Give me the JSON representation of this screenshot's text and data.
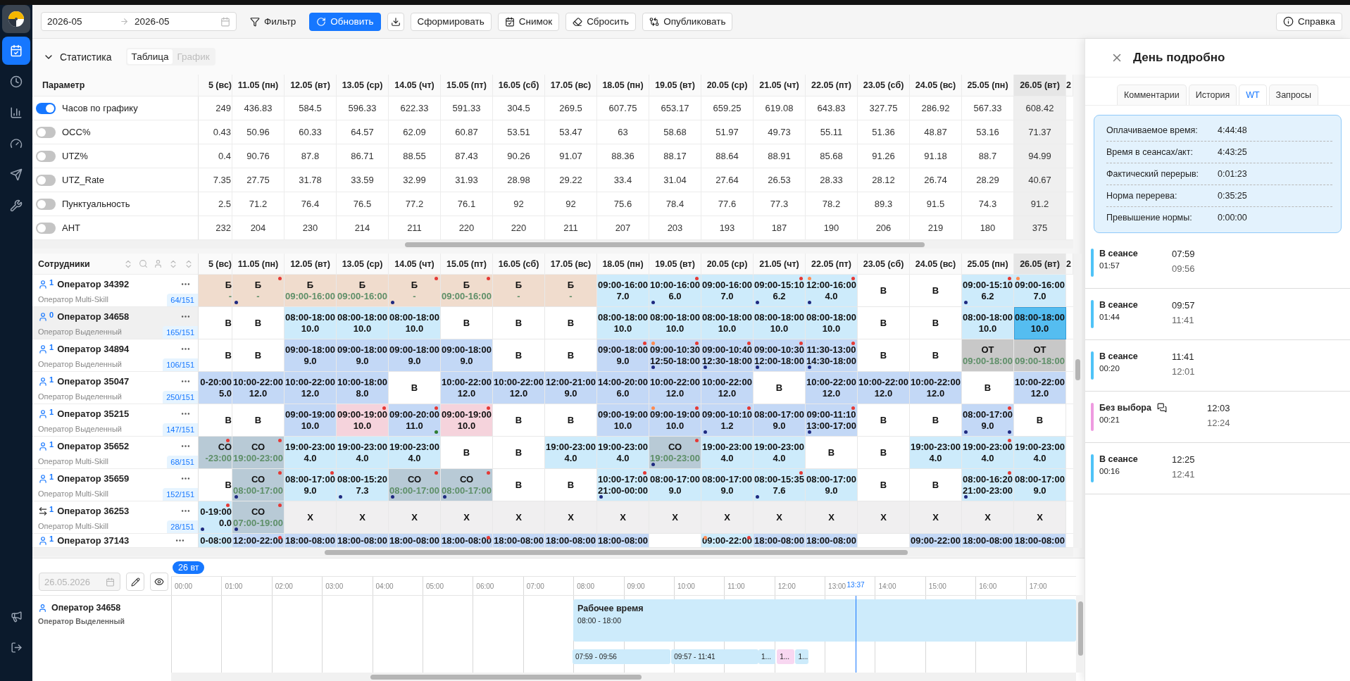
{
  "sidebar": {
    "items": [
      {
        "selected": true
      },
      {
        "selected": false
      },
      {
        "selected": false
      },
      {
        "selected": false
      },
      {
        "selected": false
      },
      {
        "selected": false
      }
    ]
  },
  "toolbar": {
    "date_from": "2026-05",
    "date_to": "2026-05",
    "buttons": [
      {
        "kind": "plain",
        "label": "Фильтр"
      },
      {
        "kind": "primary",
        "label": "Обновить"
      },
      {
        "kind": "icon"
      },
      {
        "kind": "outline",
        "label": "Сформировать"
      },
      {
        "kind": "outline",
        "label": "Снимок"
      },
      {
        "kind": "outline",
        "label": "Сбросить"
      },
      {
        "kind": "outline",
        "label": "Опубликовать"
      }
    ],
    "help": "Справка"
  },
  "stats": {
    "title": "Статистика",
    "expanded": true,
    "views": [
      {
        "label": "Таблица",
        "selected": true
      },
      {
        "label": "График",
        "selected": false
      }
    ],
    "param_header": "Параметр",
    "columns": [
      {
        "label": "5 (вс)",
        "kind": "cut-left",
        "selected": false
      },
      {
        "label": "11.05 (пн)",
        "kind": "day",
        "selected": false
      },
      {
        "label": "12.05 (вт)",
        "kind": "day",
        "selected": false
      },
      {
        "label": "13.05 (ср)",
        "kind": "day",
        "selected": false
      },
      {
        "label": "14.05 (чт)",
        "kind": "day",
        "selected": false
      },
      {
        "label": "15.05 (пт)",
        "kind": "day",
        "selected": false
      },
      {
        "label": "16.05 (сб)",
        "kind": "day",
        "selected": false
      },
      {
        "label": "17.05 (вс)",
        "kind": "day",
        "selected": false
      },
      {
        "label": "18.05 (пн)",
        "kind": "day",
        "selected": false
      },
      {
        "label": "19.05 (вт)",
        "kind": "day",
        "selected": false
      },
      {
        "label": "20.05 (ср)",
        "kind": "day",
        "selected": false
      },
      {
        "label": "21.05 (чт)",
        "kind": "day",
        "selected": false
      },
      {
        "label": "22.05 (пт)",
        "kind": "day",
        "selected": false
      },
      {
        "label": "23.05 (сб)",
        "kind": "day",
        "selected": false
      },
      {
        "label": "24.05 (вс)",
        "kind": "day",
        "selected": false
      },
      {
        "label": "25.05 (пн)",
        "kind": "day",
        "selected": false
      },
      {
        "label": "26.05 (вт)",
        "kind": "day",
        "selected": true
      },
      {
        "label": "2",
        "kind": "cut-right",
        "selected": false
      }
    ],
    "rows": [
      {
        "label": "Часов по графику",
        "on": true,
        "values": [
          "249",
          "436.83",
          "584.5",
          "596.33",
          "622.33",
          "591.33",
          "304.5",
          "269.5",
          "607.75",
          "653.17",
          "659.25",
          "619.08",
          "643.83",
          "327.75",
          "286.92",
          "567.33",
          "608.42"
        ]
      },
      {
        "label": "OCC%",
        "on": false,
        "values": [
          "0.43",
          "50.96",
          "60.33",
          "64.57",
          "62.09",
          "60.87",
          "53.51",
          "53.47",
          "63",
          "58.68",
          "51.97",
          "49.73",
          "55.11",
          "51.36",
          "48.87",
          "53.16",
          "71.37"
        ]
      },
      {
        "label": "UTZ%",
        "on": false,
        "values": [
          "0.4",
          "90.76",
          "87.8",
          "86.71",
          "88.55",
          "87.43",
          "90.26",
          "91.07",
          "88.36",
          "88.17",
          "88.64",
          "88.91",
          "85.68",
          "91.26",
          "91.18",
          "88.7",
          "94.99"
        ]
      },
      {
        "label": "UTZ_Rate",
        "on": false,
        "values": [
          "7.35",
          "27.75",
          "31.78",
          "33.59",
          "32.99",
          "31.93",
          "28.98",
          "29.22",
          "33.4",
          "31.04",
          "27.64",
          "26.53",
          "28.33",
          "28.12",
          "26.74",
          "28.29",
          "40.67"
        ]
      },
      {
        "label": "Пунктуальность",
        "on": false,
        "values": [
          "2.5",
          "71.2",
          "76.4",
          "76.5",
          "77.2",
          "76.1",
          "92",
          "92",
          "75.6",
          "78.4",
          "77.6",
          "77.3",
          "78.2",
          "89.3",
          "91.5",
          "74.3",
          "91.2"
        ]
      },
      {
        "label": "AHT",
        "on": false,
        "values": [
          "232",
          "204",
          "230",
          "214",
          "211",
          "220",
          "220",
          "211",
          "207",
          "203",
          "193",
          "187",
          "190",
          "206",
          "219",
          "180",
          "375"
        ]
      }
    ]
  },
  "schedule": {
    "header": "Сотрудники",
    "columns": [
      {
        "label": "5 (вс)",
        "kind": "cut-left",
        "selected": false
      },
      {
        "label": "11.05 (пн)",
        "kind": "day",
        "selected": false
      },
      {
        "label": "12.05 (вт)",
        "kind": "day",
        "selected": false
      },
      {
        "label": "13.05 (ср)",
        "kind": "day",
        "selected": false
      },
      {
        "label": "14.05 (чт)",
        "kind": "day",
        "selected": false
      },
      {
        "label": "15.05 (пт)",
        "kind": "day",
        "selected": false
      },
      {
        "label": "16.05 (сб)",
        "kind": "day",
        "selected": false
      },
      {
        "label": "17.05 (вс)",
        "kind": "day",
        "selected": false
      },
      {
        "label": "18.05 (пн)",
        "kind": "day",
        "selected": false
      },
      {
        "label": "19.05 (вт)",
        "kind": "day",
        "selected": false
      },
      {
        "label": "20.05 (ср)",
        "kind": "day",
        "selected": false
      },
      {
        "label": "21.05 (чт)",
        "kind": "day",
        "selected": false
      },
      {
        "label": "22.05 (пт)",
        "kind": "day",
        "selected": false
      },
      {
        "label": "23.05 (сб)",
        "kind": "day",
        "selected": false
      },
      {
        "label": "24.05 (вс)",
        "kind": "day",
        "selected": false
      },
      {
        "label": "25.05 (пн)",
        "kind": "day",
        "selected": false
      },
      {
        "label": "26.05 (вт)",
        "kind": "day",
        "selected": true
      },
      {
        "label": "2",
        "kind": "cut-right",
        "selected": false
      }
    ],
    "rows": [
      {
        "name": "Оператор 34392",
        "kind": "person",
        "sup": "1",
        "role": "Оператор Multi-Skill",
        "load": "64/151",
        "selected": false,
        "cut": false,
        "cells": [
          {
            "kind": "sick",
            "lines": [
              "Б",
              "-"
            ]
          },
          {
            "kind": "sick",
            "lines": [
              "Б",
              "-"
            ],
            "dots": [
              {
                "kind": "top-right",
                "color": "#e53935"
              },
              {
                "kind": "bottom-left",
                "color": "#1f2a80"
              }
            ]
          },
          {
            "kind": "sick",
            "lines": [
              "Б",
              "09:00-16:00"
            ]
          },
          {
            "kind": "sick",
            "lines": [
              "Б",
              "09:00-16:00"
            ]
          },
          {
            "kind": "sick",
            "lines": [
              "Б",
              "-"
            ],
            "dots": [
              {
                "kind": "top-right",
                "color": "#e53935"
              },
              {
                "kind": "bottom-left",
                "color": "#1f2a80"
              }
            ]
          },
          {
            "kind": "sick",
            "lines": [
              "Б",
              "09:00-16:00"
            ],
            "dots": [
              {
                "kind": "top-right",
                "color": "#e53935"
              }
            ]
          },
          {
            "kind": "sick",
            "lines": [
              "Б",
              "-"
            ]
          },
          {
            "kind": "sick",
            "lines": [
              "Б",
              "-"
            ]
          },
          {
            "kind": "shift",
            "lines": [
              "09:00-16:00",
              "7.0"
            ]
          },
          {
            "kind": "shift",
            "lines": [
              "10:00-16:00",
              "6.0"
            ],
            "dots": [
              {
                "kind": "top-right",
                "color": "#e53935"
              },
              {
                "kind": "bottom-left",
                "color": "#1f2a80"
              }
            ]
          },
          {
            "kind": "shift",
            "lines": [
              "09:00-16:00",
              "7.0"
            ]
          },
          {
            "kind": "shift",
            "lines": [
              "09:00-15:10",
              "6.2"
            ],
            "dots": [
              {
                "kind": "top-right",
                "color": "#e53935"
              },
              {
                "kind": "bottom-left",
                "color": "#1f2a80"
              }
            ]
          },
          {
            "kind": "shift",
            "lines": [
              "12:00-16:00",
              "4.0"
            ],
            "dots": [
              {
                "kind": "top-left",
                "color": "#ff8a50"
              },
              {
                "kind": "top-right",
                "color": "#e53935"
              },
              {
                "kind": "bottom-left",
                "color": "#1f2a80"
              }
            ]
          },
          {
            "kind": "off",
            "lines": [
              "В"
            ]
          },
          {
            "kind": "off",
            "lines": [
              "В"
            ]
          },
          {
            "kind": "shift",
            "lines": [
              "09:00-15:10",
              "6.2"
            ],
            "dots": [
              {
                "kind": "top-right",
                "color": "#e53935"
              },
              {
                "kind": "bottom-left",
                "color": "#1f2a80"
              }
            ]
          },
          {
            "kind": "shift",
            "lines": [
              "09:00-16:00",
              "7.0"
            ],
            "dots": [
              {
                "kind": "top-left",
                "color": "#ff8a50"
              }
            ]
          }
        ]
      },
      {
        "name": "Оператор 34658",
        "kind": "person",
        "sup": "0",
        "role": "Оператор Выделенный",
        "load": "165/151",
        "selected": true,
        "cut": false,
        "cells": [
          {
            "kind": "off",
            "lines": [
              "В"
            ]
          },
          {
            "kind": "off",
            "lines": [
              "В"
            ]
          },
          {
            "kind": "shift",
            "lines": [
              "08:00-18:00",
              "10.0"
            ]
          },
          {
            "kind": "shift",
            "lines": [
              "08:00-18:00",
              "10.0"
            ]
          },
          {
            "kind": "shift",
            "lines": [
              "08:00-18:00",
              "10.0"
            ]
          },
          {
            "kind": "off",
            "lines": [
              "В"
            ]
          },
          {
            "kind": "off",
            "lines": [
              "В"
            ]
          },
          {
            "kind": "off",
            "lines": [
              "В"
            ]
          },
          {
            "kind": "shift",
            "lines": [
              "08:00-18:00",
              "10.0"
            ]
          },
          {
            "kind": "shift",
            "lines": [
              "08:00-18:00",
              "10.0"
            ]
          },
          {
            "kind": "shift",
            "lines": [
              "08:00-18:00",
              "10.0"
            ]
          },
          {
            "kind": "shift",
            "lines": [
              "08:00-18:00",
              "10.0"
            ]
          },
          {
            "kind": "shift",
            "lines": [
              "08:00-18:00",
              "10.0"
            ]
          },
          {
            "kind": "off",
            "lines": [
              "В"
            ]
          },
          {
            "kind": "off",
            "lines": [
              "В"
            ]
          },
          {
            "kind": "shift",
            "lines": [
              "08:00-18:00",
              "10.0"
            ]
          },
          {
            "kind": "selected",
            "lines": [
              "08:00-18:00",
              "10.0"
            ]
          }
        ]
      },
      {
        "name": "Оператор 34894",
        "kind": "person",
        "sup": "1",
        "role": "Оператор Выделенный",
        "load": "106/151",
        "selected": false,
        "cut": false,
        "cells": [
          {
            "kind": "off",
            "lines": [
              "В"
            ]
          },
          {
            "kind": "off",
            "lines": [
              "В"
            ]
          },
          {
            "kind": "shift2",
            "lines": [
              "09:00-18:00",
              "9.0"
            ]
          },
          {
            "kind": "shift2",
            "lines": [
              "09:00-18:00",
              "9.0"
            ]
          },
          {
            "kind": "shift2",
            "lines": [
              "09:00-18:00",
              "9.0"
            ]
          },
          {
            "kind": "shift2",
            "lines": [
              "09:00-18:00",
              "9.0"
            ]
          },
          {
            "kind": "off",
            "lines": [
              "В"
            ]
          },
          {
            "kind": "off",
            "lines": [
              "В"
            ]
          },
          {
            "kind": "shift2",
            "lines": [
              "09:00-18:00",
              "9.0"
            ],
            "dots": [
              {
                "kind": "top-right",
                "color": "#e53935"
              }
            ]
          },
          {
            "kind": "shift2",
            "lines": [
              "09:00-10:30",
              "12:50-18:00"
            ],
            "dots": [
              {
                "kind": "top-left",
                "color": "#ff8a50"
              },
              {
                "kind": "top-right",
                "color": "#e53935"
              },
              {
                "kind": "bottom-left",
                "color": "#1f2a80"
              }
            ]
          },
          {
            "kind": "shift2",
            "lines": [
              "09:00-10:40",
              "12:30-18:00"
            ],
            "dots": [
              {
                "kind": "top-right",
                "color": "#e53935"
              },
              {
                "kind": "bottom-left",
                "color": "#1f2a80"
              }
            ]
          },
          {
            "kind": "shift2",
            "lines": [
              "09:00-10:30",
              "12:00-18:00"
            ],
            "dots": [
              {
                "kind": "top-right",
                "color": "#e53935"
              },
              {
                "kind": "bottom-left",
                "color": "#1f2a80"
              }
            ]
          },
          {
            "kind": "shift2",
            "lines": [
              "11:30-13:00",
              "14:30-18:00"
            ],
            "dots": [
              {
                "kind": "top-right",
                "color": "#e53935"
              },
              {
                "kind": "bottom-left",
                "color": "#1f2a80"
              }
            ]
          },
          {
            "kind": "off",
            "lines": [
              "В"
            ]
          },
          {
            "kind": "off",
            "lines": [
              "В"
            ]
          },
          {
            "kind": "ot",
            "lines": [
              "ОТ",
              "09:00-18:00"
            ]
          },
          {
            "kind": "ot",
            "lines": [
              "ОТ",
              "09:00-18:00"
            ]
          }
        ]
      },
      {
        "name": "Оператор 35047",
        "kind": "person",
        "sup": "1",
        "role": "Оператор Выделенный",
        "load": "250/151",
        "selected": false,
        "cut": false,
        "cells": [
          {
            "kind": "shift2",
            "lines": [
              "0-20:00",
              "5.0"
            ]
          },
          {
            "kind": "shift2",
            "lines": [
              "10:00-22:00",
              "12.0"
            ]
          },
          {
            "kind": "shift2",
            "lines": [
              "10:00-22:00",
              "12.0"
            ]
          },
          {
            "kind": "shift2",
            "lines": [
              "10:00-18:00",
              "8.0"
            ]
          },
          {
            "kind": "off",
            "lines": [
              "В"
            ]
          },
          {
            "kind": "shift2",
            "lines": [
              "10:00-22:00",
              "12.0"
            ]
          },
          {
            "kind": "shift2",
            "lines": [
              "10:00-22:00",
              "12.0"
            ]
          },
          {
            "kind": "shift2",
            "lines": [
              "12:00-21:00",
              "9.0"
            ]
          },
          {
            "kind": "shift2",
            "lines": [
              "14:00-20:00",
              "6.0"
            ]
          },
          {
            "kind": "shift2",
            "lines": [
              "10:00-22:00",
              "12.0"
            ]
          },
          {
            "kind": "shift2",
            "lines": [
              "10:00-22:00",
              "12.0"
            ]
          },
          {
            "kind": "off",
            "lines": [
              "В"
            ]
          },
          {
            "kind": "shift2",
            "lines": [
              "10:00-22:00",
              "12.0"
            ]
          },
          {
            "kind": "shift2",
            "lines": [
              "10:00-22:00",
              "12.0"
            ]
          },
          {
            "kind": "shift2",
            "lines": [
              "10:00-22:00",
              "12.0"
            ]
          },
          {
            "kind": "off",
            "lines": [
              "В"
            ]
          },
          {
            "kind": "shift2",
            "lines": [
              "10:00-22:00",
              "12.0"
            ]
          }
        ]
      },
      {
        "name": "Оператор 35215",
        "kind": "person",
        "sup": "1",
        "role": "Оператор Выделенный",
        "load": "147/151",
        "selected": false,
        "cut": false,
        "cells": [
          {
            "kind": "off",
            "lines": [
              "В"
            ]
          },
          {
            "kind": "off",
            "lines": [
              "В"
            ]
          },
          {
            "kind": "shift2",
            "lines": [
              "09:00-19:00",
              "10.0"
            ]
          },
          {
            "kind": "pink",
            "lines": [
              "09:00-19:00",
              "10.0"
            ],
            "dots": [
              {
                "kind": "top-right",
                "color": "#e53935"
              }
            ]
          },
          {
            "kind": "shift2",
            "lines": [
              "09:00-20:00",
              "11.0"
            ],
            "dots": [
              {
                "kind": "top-right",
                "color": "#e53935"
              },
              {
                "kind": "bottom-right",
                "color": "#2e7d32"
              }
            ]
          },
          {
            "kind": "pink",
            "lines": [
              "09:00-19:00",
              "10.0"
            ],
            "dots": [
              {
                "kind": "top-right",
                "color": "#e53935"
              }
            ]
          },
          {
            "kind": "off",
            "lines": [
              "В"
            ]
          },
          {
            "kind": "off",
            "lines": [
              "В"
            ]
          },
          {
            "kind": "shift2",
            "lines": [
              "09:00-19:00",
              "10.0"
            ]
          },
          {
            "kind": "shift2",
            "lines": [
              "09:00-19:00",
              "10.0"
            ],
            "dots": [
              {
                "kind": "top-left",
                "color": "#ff8a50"
              },
              {
                "kind": "top-right",
                "color": "#e53935"
              }
            ]
          },
          {
            "kind": "shift2",
            "lines": [
              "09:00-10:10",
              "1.2"
            ],
            "dots": [
              {
                "kind": "top-right",
                "color": "#e53935"
              },
              {
                "kind": "bottom-left",
                "color": "#1f2a80"
              }
            ]
          },
          {
            "kind": "shift2",
            "lines": [
              "08:00-17:00",
              "9.0"
            ]
          },
          {
            "kind": "shift2",
            "lines": [
              "09:00-11:10",
              "13:00-17:00"
            ],
            "dots": [
              {
                "kind": "top-right",
                "color": "#e53935"
              },
              {
                "kind": "bottom-left",
                "color": "#1f2a80"
              }
            ]
          },
          {
            "kind": "off",
            "lines": [
              "В"
            ]
          },
          {
            "kind": "off",
            "lines": [
              "В"
            ]
          },
          {
            "kind": "shift2",
            "lines": [
              "08:00-17:00",
              "9.0"
            ],
            "dots": [
              {
                "kind": "top-right",
                "color": "#e53935"
              },
              {
                "kind": "bottom-left",
                "color": "#1f2a80"
              },
              {
                "kind": "bottom-right",
                "color": "#1f2a80"
              }
            ]
          },
          {
            "kind": "off",
            "lines": [
              "В"
            ]
          }
        ]
      },
      {
        "name": "Оператор 35652",
        "kind": "person",
        "sup": "1",
        "role": "Оператор Multi-Skill",
        "load": "68/151",
        "selected": false,
        "cut": false,
        "cells": [
          {
            "kind": "co",
            "lines": [
              "СО",
              "-23:00"
            ],
            "dots": [
              {
                "kind": "top-right",
                "color": "#e53935"
              }
            ]
          },
          {
            "kind": "co",
            "lines": [
              "СО",
              "19:00-23:00"
            ],
            "dots": [
              {
                "kind": "top-right",
                "color": "#e53935"
              }
            ]
          },
          {
            "kind": "shift",
            "lines": [
              "19:00-23:00",
              "4.0"
            ]
          },
          {
            "kind": "shift",
            "lines": [
              "19:00-23:00",
              "4.0"
            ]
          },
          {
            "kind": "shift",
            "lines": [
              "19:00-23:00",
              "4.0"
            ]
          },
          {
            "kind": "off",
            "lines": [
              "В"
            ]
          },
          {
            "kind": "off",
            "lines": [
              "В"
            ]
          },
          {
            "kind": "shift",
            "lines": [
              "19:00-23:00",
              "4.0"
            ]
          },
          {
            "kind": "shift",
            "lines": [
              "19:00-23:00",
              "4.0"
            ]
          },
          {
            "kind": "co",
            "lines": [
              "СО",
              "19:00-23:00"
            ],
            "dots": [
              {
                "kind": "top-right",
                "color": "#e53935"
              },
              {
                "kind": "bottom-left",
                "color": "#1f2a80"
              }
            ]
          },
          {
            "kind": "shift",
            "lines": [
              "19:00-23:00",
              "4.0"
            ]
          },
          {
            "kind": "shift",
            "lines": [
              "19:00-23:00",
              "4.0"
            ]
          },
          {
            "kind": "off",
            "lines": [
              "В"
            ]
          },
          {
            "kind": "off",
            "lines": [
              "В"
            ]
          },
          {
            "kind": "shift",
            "lines": [
              "19:00-23:00",
              "4.0"
            ]
          },
          {
            "kind": "shift",
            "lines": [
              "19:00-23:00",
              "4.0"
            ],
            "dots": [
              {
                "kind": "top-right",
                "color": "#e53935"
              }
            ]
          },
          {
            "kind": "shift",
            "lines": [
              "19:00-23:00",
              "4.0"
            ]
          }
        ]
      },
      {
        "name": "Оператор 35659",
        "kind": "person",
        "sup": "1",
        "role": "Оператор Multi-Skill",
        "load": "152/151",
        "selected": false,
        "cut": false,
        "cells": [
          {
            "kind": "off",
            "lines": [
              "В"
            ]
          },
          {
            "kind": "co",
            "lines": [
              "СО",
              "08:00-17:00"
            ],
            "dots": [
              {
                "kind": "top-right",
                "color": "#e53935"
              },
              {
                "kind": "bottom-left",
                "color": "#1f2a80"
              }
            ]
          },
          {
            "kind": "shift",
            "lines": [
              "08:00-17:00",
              "9.0"
            ],
            "dots": [
              {
                "kind": "top-right",
                "color": "#e53935"
              }
            ]
          },
          {
            "kind": "shift",
            "lines": [
              "08:00-15:20",
              "7.3"
            ],
            "dots": [
              {
                "kind": "bottom-left",
                "color": "#1f2a80"
              }
            ]
          },
          {
            "kind": "co",
            "lines": [
              "СО",
              "08:00-17:00"
            ],
            "dots": [
              {
                "kind": "top-right",
                "color": "#e53935"
              },
              {
                "kind": "bottom-left",
                "color": "#1f2a80"
              }
            ]
          },
          {
            "kind": "co",
            "lines": [
              "СО",
              "08:00-17:00"
            ],
            "dots": [
              {
                "kind": "top-right",
                "color": "#e53935"
              },
              {
                "kind": "bottom-left",
                "color": "#1f2a80"
              }
            ]
          },
          {
            "kind": "off",
            "lines": [
              "В"
            ]
          },
          {
            "kind": "off",
            "lines": [
              "В"
            ]
          },
          {
            "kind": "shift",
            "lines": [
              "10:00-17:00",
              "21:00-00:00"
            ],
            "dots": [
              {
                "kind": "top-right",
                "color": "#e53935"
              },
              {
                "kind": "bottom-left",
                "color": "#1f2a80"
              }
            ]
          },
          {
            "kind": "shift",
            "lines": [
              "08:00-17:00",
              "9.0"
            ]
          },
          {
            "kind": "shift",
            "lines": [
              "08:00-17:00",
              "9.0"
            ]
          },
          {
            "kind": "shift",
            "lines": [
              "08:00-15:35",
              "7.6"
            ],
            "dots": [
              {
                "kind": "top-right",
                "color": "#e53935"
              },
              {
                "kind": "bottom-left",
                "color": "#1f2a80"
              }
            ]
          },
          {
            "kind": "shift",
            "lines": [
              "08:00-17:00",
              "9.0"
            ]
          },
          {
            "kind": "off",
            "lines": [
              "В"
            ]
          },
          {
            "kind": "off",
            "lines": [
              "В"
            ]
          },
          {
            "kind": "shift",
            "lines": [
              "08:00-16:20",
              "21:00-23:00"
            ],
            "dots": [
              {
                "kind": "top-right",
                "color": "#e53935"
              },
              {
                "kind": "bottom-left",
                "color": "#1f2a80"
              }
            ]
          },
          {
            "kind": "shift",
            "lines": [
              "08:00-17:00",
              "9.0"
            ]
          }
        ]
      },
      {
        "name": "Оператор 36253",
        "kind": "swap",
        "sup": "1",
        "role": "Оператор Multi-Skill",
        "load": "28/151",
        "selected": false,
        "cut": false,
        "cells": [
          {
            "kind": "shift",
            "lines": [
              "0-19:00",
              "0.0"
            ],
            "dots": [
              {
                "kind": "top-right",
                "color": "#e53935"
              },
              {
                "kind": "bottom-left",
                "color": "#1f2a80"
              }
            ]
          },
          {
            "kind": "co",
            "lines": [
              "СО",
              "07:00-19:00"
            ],
            "dots": [
              {
                "kind": "top-right",
                "color": "#e53935"
              },
              {
                "kind": "bottom-left",
                "color": "#1f2a80"
              }
            ]
          },
          {
            "kind": "x",
            "lines": [
              "Х"
            ]
          },
          {
            "kind": "x",
            "lines": [
              "Х"
            ]
          },
          {
            "kind": "x",
            "lines": [
              "Х"
            ]
          },
          {
            "kind": "x",
            "lines": [
              "Х"
            ]
          },
          {
            "kind": "x",
            "lines": [
              "Х"
            ]
          },
          {
            "kind": "x",
            "lines": [
              "Х"
            ]
          },
          {
            "kind": "x",
            "lines": [
              "Х"
            ]
          },
          {
            "kind": "x",
            "lines": [
              "Х"
            ]
          },
          {
            "kind": "x",
            "lines": [
              "Х"
            ]
          },
          {
            "kind": "x",
            "lines": [
              "Х"
            ]
          },
          {
            "kind": "x",
            "lines": [
              "Х"
            ]
          },
          {
            "kind": "x",
            "lines": [
              "Х"
            ]
          },
          {
            "kind": "x",
            "lines": [
              "Х"
            ]
          },
          {
            "kind": "x",
            "lines": [
              "Х"
            ]
          },
          {
            "kind": "x",
            "lines": [
              "Х"
            ]
          }
        ]
      },
      {
        "name": "Оператор 37143",
        "kind": "person",
        "sup": "1",
        "selected": false,
        "cut": true,
        "cells": [
          {
            "kind": "shift",
            "lines": [
              "0-08:00"
            ]
          },
          {
            "kind": "shift2",
            "lines": [
              "12:00-22:00"
            ],
            "dots": [
              {
                "kind": "top-right",
                "color": "#e53935"
              }
            ]
          },
          {
            "kind": "shift2",
            "lines": [
              "18:00-08:00"
            ]
          },
          {
            "kind": "shift2",
            "lines": [
              "18:00-08:00"
            ]
          },
          {
            "kind": "shift2",
            "lines": [
              "18:00-08:00"
            ]
          },
          {
            "kind": "shift2",
            "lines": [
              "18:00-08:00"
            ],
            "dots": [
              {
                "kind": "top-right",
                "color": "#e53935"
              }
            ]
          },
          {
            "kind": "shift2",
            "lines": [
              "18:00-08:00"
            ]
          },
          {
            "kind": "shift2",
            "lines": [
              "18:00-08:00"
            ]
          },
          {
            "kind": "shift2",
            "lines": [
              "18:00-08:00"
            ]
          },
          {
            "kind": "off"
          },
          {
            "kind": "shift",
            "lines": [
              "09:00-22:00"
            ],
            "dots": [
              {
                "kind": "top-left",
                "color": "#ff8a50"
              },
              {
                "kind": "top-right",
                "color": "#e53935"
              }
            ]
          },
          {
            "kind": "shift2",
            "lines": [
              "18:00-08:00"
            ]
          },
          {
            "kind": "shift2",
            "lines": [
              "18:00-08:00"
            ]
          },
          {
            "kind": "off"
          },
          {
            "kind": "shift2",
            "lines": [
              "09:00-22:00"
            ]
          },
          {
            "kind": "shift2",
            "lines": [
              "18:00-08:00"
            ]
          },
          {
            "kind": "shift2",
            "lines": [
              "18:00-08:00"
            ]
          }
        ]
      }
    ]
  },
  "timeline": {
    "date": "26.05.2026",
    "disabled": true,
    "day_badge": "26 вт",
    "hours": [
      "00:00",
      "01:00",
      "02:00",
      "03:00",
      "04:00",
      "05:00",
      "06:00",
      "07:00",
      "08:00",
      "09:00",
      "10:00",
      "11:00",
      "12:00",
      "13:00",
      "14:00",
      "15:00",
      "16:00",
      "17:00"
    ],
    "now": "13:37",
    "employee": {
      "name": "Оператор 34658",
      "role": "Оператор Выделенный"
    },
    "work": {
      "title": "Рабочее время",
      "range": "08:00 - 18:00"
    },
    "segments": [
      {
        "label": "07:59 - 09:56",
        "color": "#cdebfb"
      },
      {
        "label": "09:57 - 11:41",
        "color": "#cdebfb"
      },
      {
        "label": "1...",
        "color": "#cdebfb"
      },
      {
        "label": "1...",
        "color": "#f8d7f1"
      },
      {
        "label": "1...",
        "color": "#cdebfb"
      }
    ]
  },
  "panel": {
    "title": "День подробно",
    "tabs": [
      {
        "label": "Комментарии",
        "selected": false
      },
      {
        "label": "История",
        "selected": false
      },
      {
        "label": "WT",
        "selected": true
      },
      {
        "label": "Запросы",
        "selected": false
      }
    ],
    "summary": [
      {
        "label": "Оплачиваемое время:",
        "value": "4:44:48"
      },
      {
        "label": "Время в сеансах/акт:",
        "value": "4:43:25"
      },
      {
        "label": "Фактический перерыв:",
        "value": "0:01:23"
      },
      {
        "label": "Норма перерева:",
        "value": "0:35:25"
      },
      {
        "label": "Превышение нормы:",
        "value": "0:00:00"
      }
    ],
    "sessions": [
      {
        "title": "В сеансе",
        "duration": "01:57",
        "start": "07:59",
        "end": "09:56",
        "color": "#4fc3f7",
        "comment": false
      },
      {
        "title": "В сеансе",
        "duration": "01:44",
        "start": "09:57",
        "end": "11:41",
        "color": "#4fc3f7",
        "comment": false
      },
      {
        "title": "В сеансе",
        "duration": "00:20",
        "start": "11:41",
        "end": "12:01",
        "color": "#4fc3f7",
        "comment": false
      },
      {
        "title": "Без выбора",
        "duration": "00:21",
        "start": "12:03",
        "end": "12:24",
        "color": "#ee9ae0",
        "comment": true
      },
      {
        "title": "В сеансе",
        "duration": "00:16",
        "start": "12:25",
        "end": "12:41",
        "color": "#4fc3f7",
        "comment": false
      }
    ]
  }
}
